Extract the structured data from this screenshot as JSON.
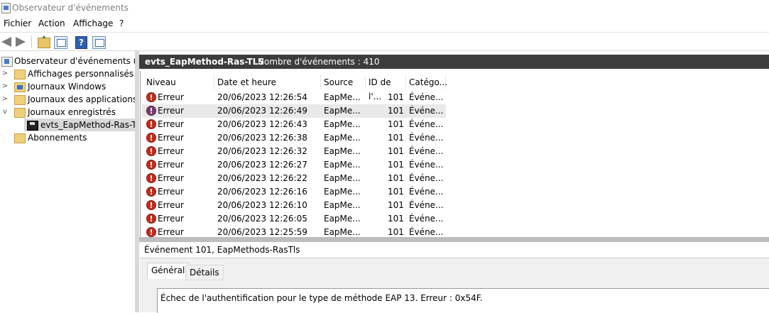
{
  "window": {
    "title": "Observateur d'événements"
  },
  "menu": [
    "Fichier",
    "Action",
    "Affichage",
    "?"
  ],
  "toolbar": {
    "buttons": [
      "back-arrow-icon",
      "forward-arrow-icon",
      "folder-up-icon",
      "show-hide-tree-icon",
      "help-icon",
      "show-hide-action-icon"
    ],
    "help_label": "?"
  },
  "tree": {
    "root": "Observateur d'événements (Loca",
    "items": [
      {
        "label": "Affichages personnalisés",
        "chevron": ">"
      },
      {
        "label": "Journaux Windows",
        "chevron": ">"
      },
      {
        "label": "Journaux des applications et",
        "chevron": ">"
      },
      {
        "label": "Journaux enregistrés",
        "chevron": "v"
      },
      {
        "label": "evts_EapMethod-Ras-TLS",
        "chevron": ""
      },
      {
        "label": "Abonnements",
        "chevron": ""
      }
    ]
  },
  "pane_header": {
    "name": "evts_EapMethod-Ras-TLS",
    "count": "Nombre d'événements : 410"
  },
  "columns": [
    "Niveau",
    "Date et heure",
    "Source",
    "ID de l'...",
    "Catégo..."
  ],
  "events": [
    {
      "level": "Erreur",
      "datetime": "20/06/2023 12:26:54",
      "source": "EapMe...",
      "id": "101",
      "category": "Événe..."
    },
    {
      "level": "Erreur",
      "datetime": "20/06/2023 12:26:49",
      "source": "EapMe...",
      "id": "101",
      "category": "Événe..."
    },
    {
      "level": "Erreur",
      "datetime": "20/06/2023 12:26:43",
      "source": "EapMe...",
      "id": "101",
      "category": "Événe..."
    },
    {
      "level": "Erreur",
      "datetime": "20/06/2023 12:26:38",
      "source": "EapMe...",
      "id": "101",
      "category": "Événe..."
    },
    {
      "level": "Erreur",
      "datetime": "20/06/2023 12:26:32",
      "source": "EapMe...",
      "id": "101",
      "category": "Événe..."
    },
    {
      "level": "Erreur",
      "datetime": "20/06/2023 12:26:27",
      "source": "EapMe...",
      "id": "101",
      "category": "Événe..."
    },
    {
      "level": "Erreur",
      "datetime": "20/06/2023 12:26:22",
      "source": "EapMe...",
      "id": "101",
      "category": "Événe..."
    },
    {
      "level": "Erreur",
      "datetime": "20/06/2023 12:26:16",
      "source": "EapMe...",
      "id": "101",
      "category": "Événe..."
    },
    {
      "level": "Erreur",
      "datetime": "20/06/2023 12:26:10",
      "source": "EapMe...",
      "id": "101",
      "category": "Événe..."
    },
    {
      "level": "Erreur",
      "datetime": "20/06/2023 12:26:05",
      "source": "EapMe...",
      "id": "101",
      "category": "Événe..."
    },
    {
      "level": "Erreur",
      "datetime": "20/06/2023 12:25:59",
      "source": "EapMe...",
      "id": "101",
      "category": "Événe..."
    }
  ],
  "detail": {
    "title": "Événement 101, EapMethods-RasTls",
    "tabs": [
      "Général",
      "Détails"
    ],
    "message": "Échec de l'authentification pour le type de méthode EAP 13. Erreur : 0x54F."
  },
  "colors": {
    "header_bg": "#3c3c3c",
    "error_red": "#c42b1c",
    "selected_row": "#e9e9e9"
  }
}
